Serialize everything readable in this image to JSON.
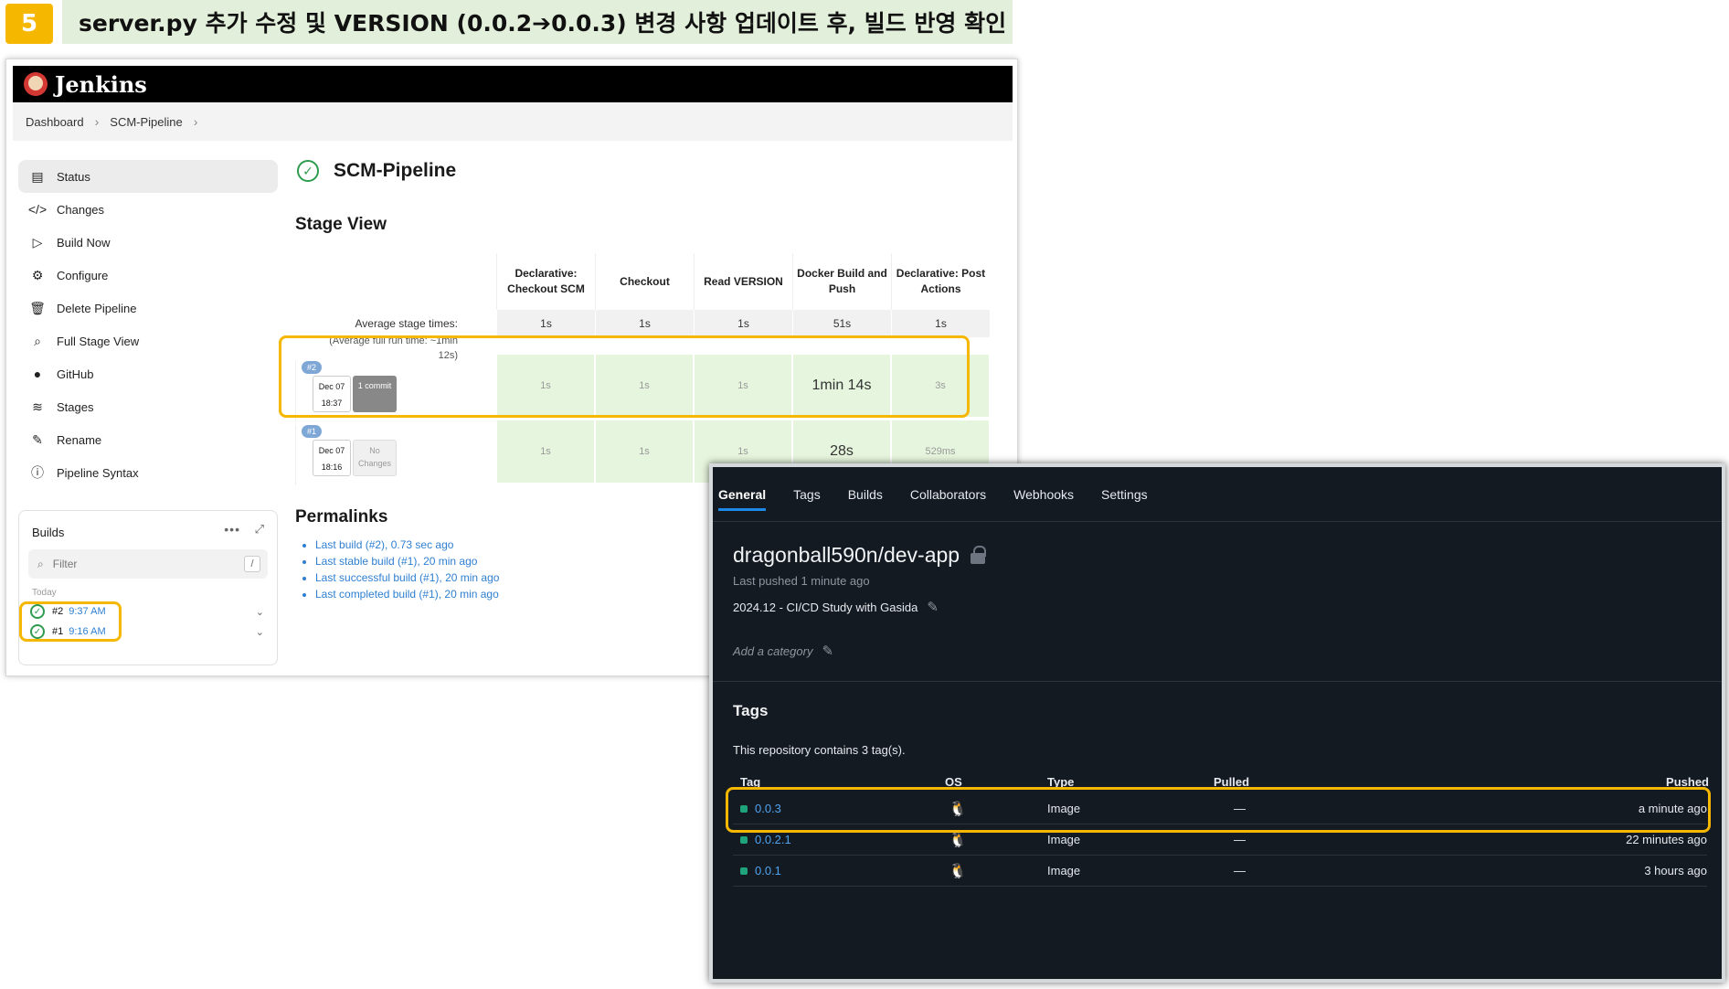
{
  "banner": {
    "step": "5",
    "text": "server.py 추가 수정 및 VERSION (0.0.2➔0.0.3) 변경 사항 업데이트 후, 빌드 반영 확인"
  },
  "jenkins": {
    "title": "Jenkins",
    "breadcrumb": [
      "Dashboard",
      "SCM-Pipeline"
    ],
    "sidebar": [
      {
        "label": "Status",
        "icon": "document-icon"
      },
      {
        "label": "Changes",
        "icon": "code-icon"
      },
      {
        "label": "Build Now",
        "icon": "play-icon"
      },
      {
        "label": "Configure",
        "icon": "gear-icon"
      },
      {
        "label": "Delete Pipeline",
        "icon": "trash-icon"
      },
      {
        "label": "Full Stage View",
        "icon": "search-icon"
      },
      {
        "label": "GitHub",
        "icon": "github-icon"
      },
      {
        "label": "Stages",
        "icon": "layers-icon"
      },
      {
        "label": "Rename",
        "icon": "pencil-icon"
      },
      {
        "label": "Pipeline Syntax",
        "icon": "help-icon"
      }
    ],
    "builds": {
      "title": "Builds",
      "filter_placeholder": "Filter",
      "filter_shortcut": "/",
      "group": "Today",
      "items": [
        {
          "number": "#2",
          "time": "9:37 AM"
        },
        {
          "number": "#1",
          "time": "9:16 AM"
        }
      ]
    },
    "page_title": "SCM-Pipeline",
    "stage_view": {
      "title": "Stage View",
      "avg_label": "Average stage times:",
      "avg_full_run": "(Average full run time: ~1min 12s)",
      "stages": [
        {
          "name": "Declarative: Checkout SCM",
          "avg": "1s"
        },
        {
          "name": "Checkout",
          "avg": "1s"
        },
        {
          "name": "Read VERSION",
          "avg": "1s"
        },
        {
          "name": "Docker Build and Push",
          "avg": "51s"
        },
        {
          "name": "Declarative: Post Actions",
          "avg": "1s"
        }
      ],
      "runs": [
        {
          "badge": "#2",
          "date": "Dec 07",
          "time": "18:37",
          "changes": "1 commit",
          "times": [
            "1s",
            "1s",
            "1s",
            "1min 14s",
            "3s"
          ]
        },
        {
          "badge": "#1",
          "date": "Dec 07",
          "time": "18:16",
          "changes": "No Changes",
          "times": [
            "1s",
            "1s",
            "1s",
            "28s",
            "529ms"
          ]
        }
      ]
    },
    "permalinks": {
      "title": "Permalinks",
      "items": [
        "Last build (#2), 0.73 sec ago",
        "Last stable build (#1), 20 min ago",
        "Last successful build (#1), 20 min ago",
        "Last completed build (#1), 20 min ago"
      ]
    }
  },
  "dockerhub": {
    "tabs": [
      "General",
      "Tags",
      "Builds",
      "Collaborators",
      "Webhooks",
      "Settings"
    ],
    "active_tab": "General",
    "repo": "dragonball590n/dev-app",
    "last_pushed": "Last pushed 1 minute ago",
    "description": "2024.12 - CI/CD Study with Gasida",
    "category_prompt": "Add a category",
    "tags_title": "Tags",
    "tags_count": "This repository contains 3 tag(s).",
    "columns": [
      "Tag",
      "OS",
      "Type",
      "Pulled",
      "Pushed"
    ],
    "rows": [
      {
        "tag": "0.0.3",
        "os": "linux-icon",
        "type": "Image",
        "pulled": "—",
        "pushed": "a minute ago"
      },
      {
        "tag": "0.0.2.1",
        "os": "linux-icon",
        "type": "Image",
        "pulled": "—",
        "pushed": "22 minutes ago"
      },
      {
        "tag": "0.0.1",
        "os": "linux-icon",
        "type": "Image",
        "pulled": "—",
        "pushed": "3 hours ago"
      }
    ]
  },
  "colors": {
    "highlight": "#f5b700",
    "banner_bg": "#e2efda",
    "stage_success": "#e6f5dd",
    "hub_bg": "#141a22",
    "link": "#2e7fd1"
  }
}
